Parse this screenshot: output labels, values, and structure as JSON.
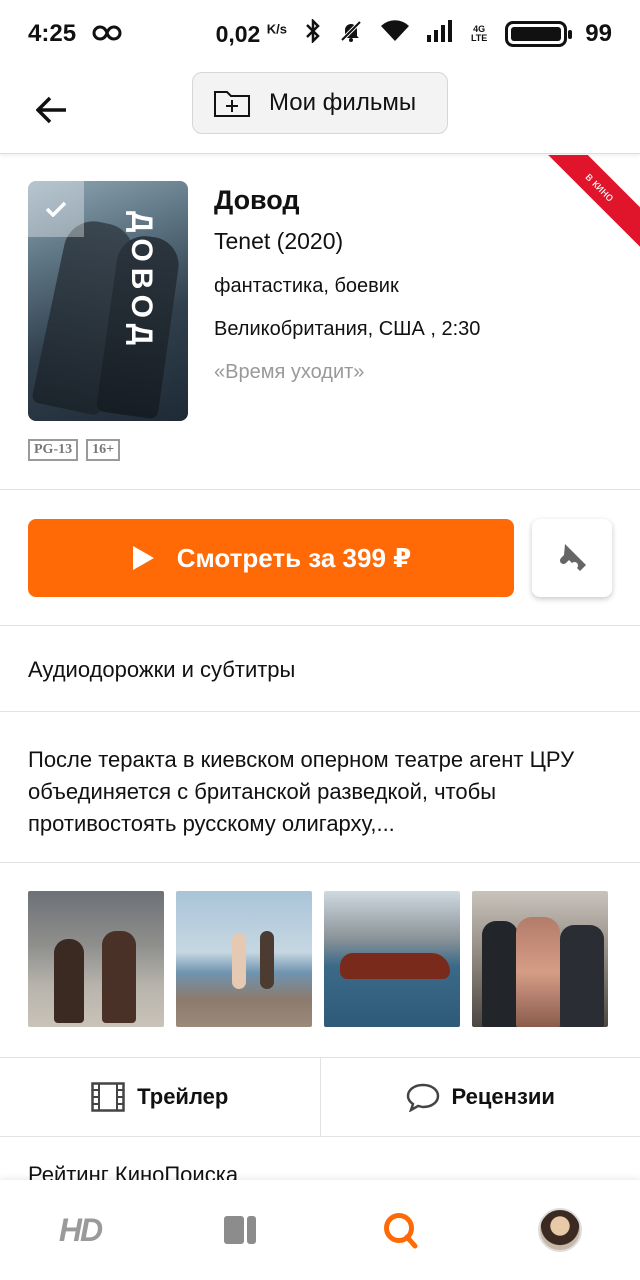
{
  "status_bar": {
    "time": "4:25",
    "speed_value": "0,02",
    "speed_unit": "K/s",
    "network": "4G",
    "network_sub": "LTE",
    "battery": "99"
  },
  "app_bar": {
    "my_films_label": "Мои фильмы"
  },
  "movie": {
    "poster_title": "ДОВОД",
    "title_ru": "Довод",
    "title_en": "Tenet (2020)",
    "genres": "фантастика, боевик",
    "country_duration": "Великобритания, США , 2:30",
    "slogan": "«Время уходит»",
    "ratings": [
      "PG-13",
      "16+"
    ],
    "corner_badge": "в кино"
  },
  "actions": {
    "watch_label": "Смотреть за 399 ₽",
    "accent_color": "#ff6a06"
  },
  "audio_subtitles_label": "Аудиодорожки и субтитры",
  "description": "После теракта в киевском оперном театре агент ЦРУ объединяется с британской разведкой, чтобы противостоять русскому олигарху,...",
  "tabs": {
    "trailer_label": "Трейлер",
    "reviews_label": "Рецензии"
  },
  "peek_text": "Рейтинг КиноПоиска",
  "bottom_nav": {
    "hd_label": "HD",
    "items": [
      "hd-icon",
      "library-icon",
      "search-icon",
      "profile-avatar"
    ],
    "active": "search-icon"
  }
}
